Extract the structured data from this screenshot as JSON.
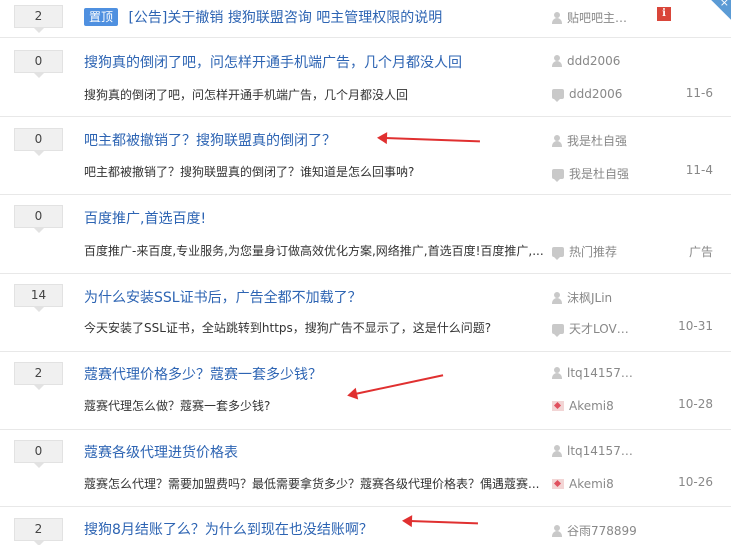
{
  "threads": [
    {
      "reply_count": "2",
      "pinned_label": "置顶",
      "title": "[公告]关于撤销 搜狗联盟咨询 吧主管理权限的说明",
      "author": "贴吧吧主…",
      "excerpt": "",
      "last_replier": "",
      "date": ""
    },
    {
      "reply_count": "0",
      "title": "搜狗真的倒闭了吧，问怎样开通手机端广告，几个月都没人回",
      "author": "ddd2006",
      "excerpt": "搜狗真的倒闭了吧，问怎样开通手机端广告，几个月都没人回",
      "last_replier": "ddd2006",
      "date": "11-6"
    },
    {
      "reply_count": "0",
      "title": "吧主都被撤销了？搜狗联盟真的倒闭了？",
      "author": "我是杜自强",
      "excerpt": "吧主都被撤销了？搜狗联盟真的倒闭了？谁知道是怎么回事呐?",
      "last_replier": "我是杜自强",
      "date": "11-4"
    },
    {
      "reply_count": "0",
      "title": "百度推广,首选百度!",
      "author": "",
      "excerpt": "百度推广-来百度,专业服务,为您量身订做高效优化方案,网络推广,首选百度!百度推广,...",
      "last_replier": "热门推荐",
      "date": "广告"
    },
    {
      "reply_count": "14",
      "title": "为什么安装SSL证书后，广告全都不加载了？",
      "author": "沫枫JLin",
      "excerpt": "今天安装了SSL证书，全站跳转到https，搜狗广告不显示了，这是什么问题?",
      "last_replier": "天才LOV…",
      "date": "10-31"
    },
    {
      "reply_count": "2",
      "title": "蔻赛代理价格多少？蔻赛一套多少钱？",
      "author": "ltq14157…",
      "excerpt": "蔻赛代理怎么做？蔻赛一套多少钱?",
      "last_replier": "Akemi8",
      "date": "10-28"
    },
    {
      "reply_count": "0",
      "title": "蔻赛各级代理进货价格表",
      "author": "ltq14157…",
      "excerpt": "蔻赛怎么代理？需要加盟费吗？最低需要拿货多少？蔻赛各级代理价格表？偶遇蔻赛...",
      "last_replier": "Akemi8",
      "date": "10-26"
    },
    {
      "reply_count": "2",
      "title": "搜狗8月结账了么？为什么到现在也没结账啊？",
      "author": "谷雨778899",
      "excerpt": "",
      "last_replier": "",
      "date": ""
    }
  ],
  "colors": {
    "link": "#2d64b3",
    "pin_badge": "#4f90e0",
    "annotation_arrow": "#e03030",
    "alert": "#d9463a"
  },
  "icons": {
    "alert_glyph": "i",
    "corner_glyph": "×"
  }
}
